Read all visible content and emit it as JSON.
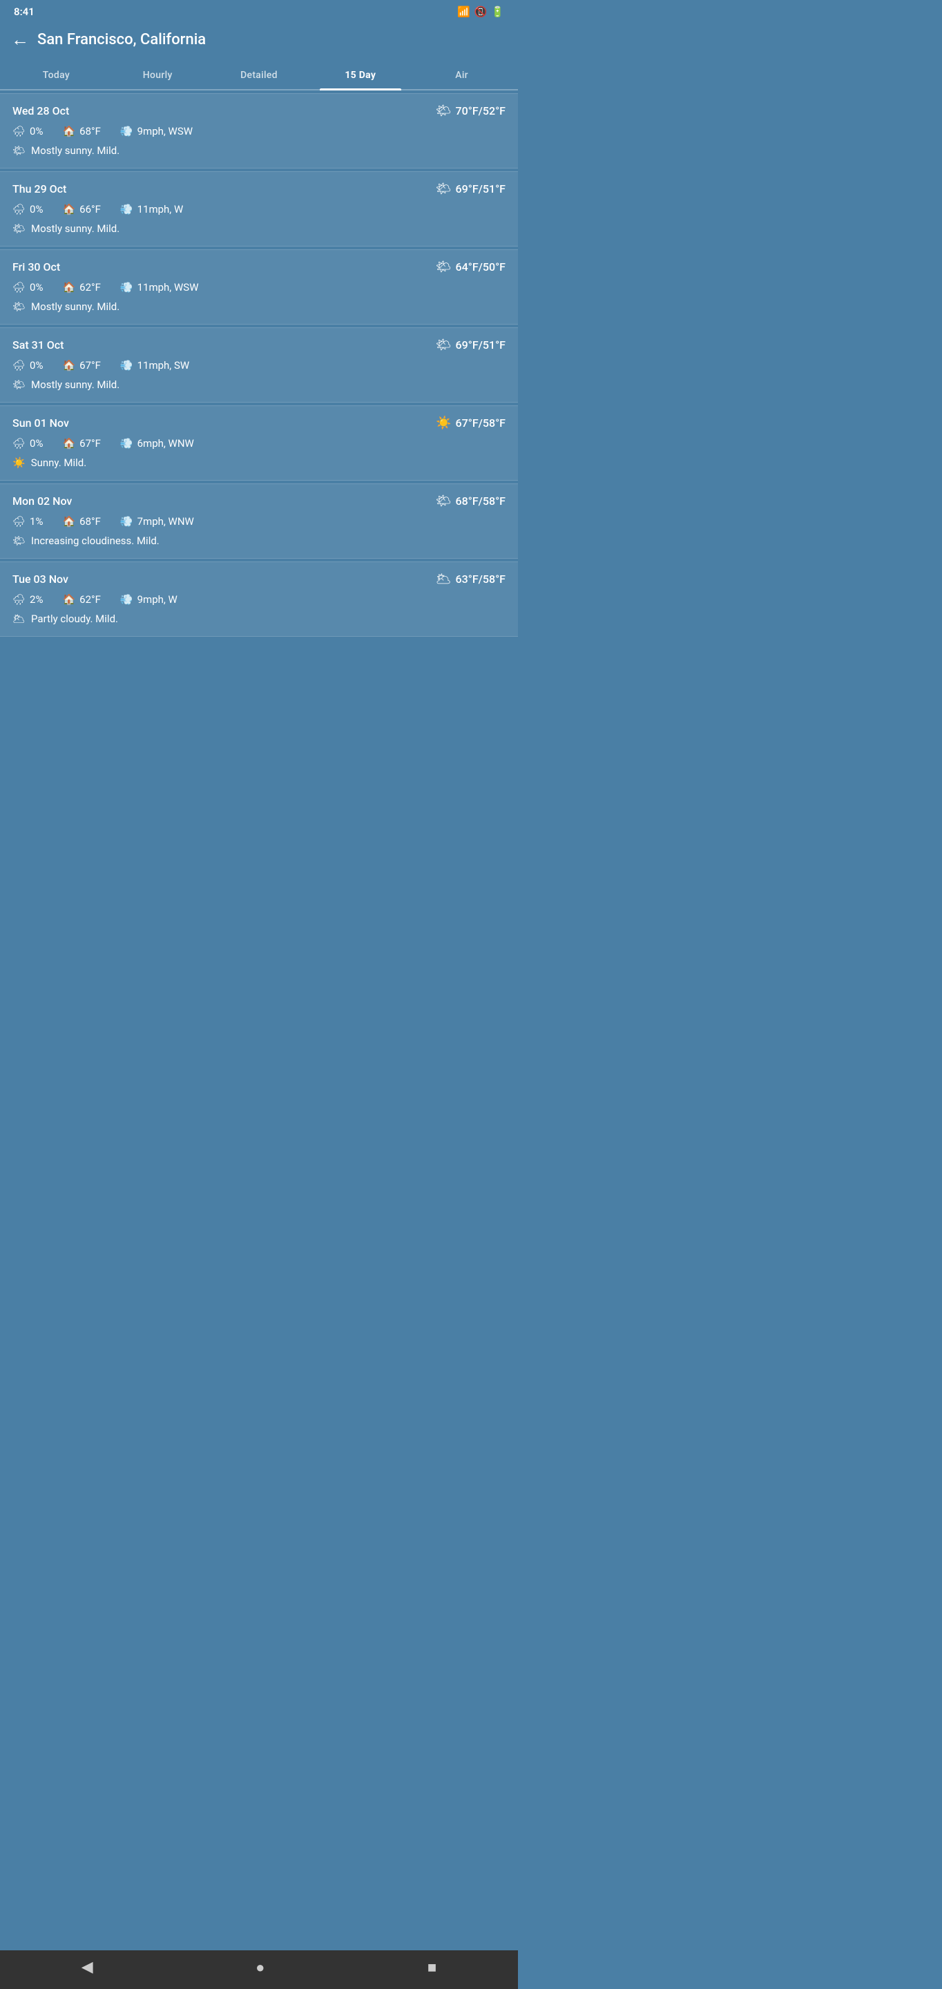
{
  "statusBar": {
    "time": "8:41",
    "icons": [
      "wifi",
      "signal",
      "battery"
    ]
  },
  "header": {
    "title": "San Francisco, California",
    "backLabel": "←"
  },
  "tabs": [
    {
      "id": "today",
      "label": "Today",
      "active": false
    },
    {
      "id": "hourly",
      "label": "Hourly",
      "active": false
    },
    {
      "id": "detailed",
      "label": "Detailed",
      "active": false
    },
    {
      "id": "15day",
      "label": "15 Day",
      "active": true
    },
    {
      "id": "air",
      "label": "Air",
      "active": false
    }
  ],
  "days": [
    {
      "date": "Wed 28 Oct",
      "tempHigh": "70°F",
      "tempLow": "52°F",
      "precipChance": "0%",
      "feelsLike": "68°F",
      "wind": "9mph, WSW",
      "description": "Mostly sunny. Mild."
    },
    {
      "date": "Thu 29 Oct",
      "tempHigh": "69°F",
      "tempLow": "51°F",
      "precipChance": "0%",
      "feelsLike": "66°F",
      "wind": "11mph, W",
      "description": "Mostly sunny. Mild."
    },
    {
      "date": "Fri 30 Oct",
      "tempHigh": "64°F",
      "tempLow": "50°F",
      "precipChance": "0%",
      "feelsLike": "62°F",
      "wind": "11mph, WSW",
      "description": "Mostly sunny. Mild."
    },
    {
      "date": "Sat 31 Oct",
      "tempHigh": "69°F",
      "tempLow": "51°F",
      "precipChance": "0%",
      "feelsLike": "67°F",
      "wind": "11mph, SW",
      "description": "Mostly sunny. Mild."
    },
    {
      "date": "Sun 01 Nov",
      "tempHigh": "67°F",
      "tempLow": "58°F",
      "precipChance": "0%",
      "feelsLike": "67°F",
      "wind": "6mph, WNW",
      "description": "Sunny. Mild."
    },
    {
      "date": "Mon 02 Nov",
      "tempHigh": "68°F",
      "tempLow": "58°F",
      "precipChance": "1%",
      "feelsLike": "68°F",
      "wind": "7mph, WNW",
      "description": "Increasing cloudiness. Mild."
    },
    {
      "date": "Tue 03 Nov",
      "tempHigh": "63°F",
      "tempLow": "58°F",
      "precipChance": "2%",
      "feelsLike": "62°F",
      "wind": "9mph, W",
      "description": "Partly cloudy. Mild."
    }
  ],
  "bottomNav": {
    "back": "◀",
    "home": "●",
    "square": "■"
  }
}
